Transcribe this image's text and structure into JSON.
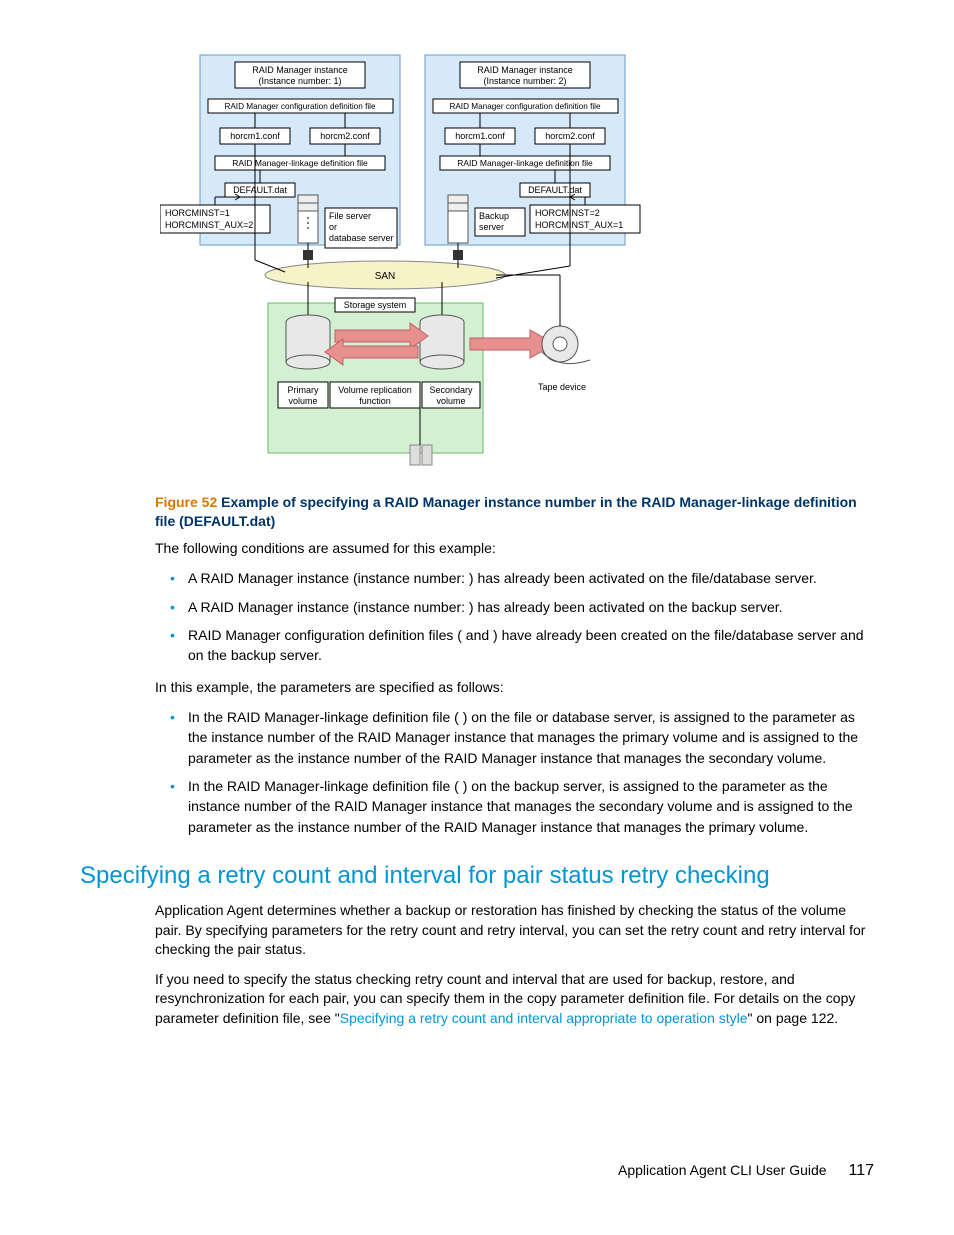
{
  "diagram": {
    "inst1_title_1": "RAID Manager instance",
    "inst1_title_2": "(Instance number: 1)",
    "inst2_title_1": "RAID Manager instance",
    "inst2_title_2": "(Instance number: 2)",
    "config_def_file": "RAID Manager configuration definition file",
    "horcm1": "horcm1.conf",
    "horcm2": "horcm2.conf",
    "linkage_file": "RAID Manager-linkage definition file",
    "default_dat": "DEFAULT.dat",
    "env1_1": "HORCMINST=1",
    "env1_2": "HORCMINST_AUX=2",
    "env2_1": "HORCMINST=2",
    "env2_2": "HORCMINST_AUX=1",
    "file_server_1": "File server",
    "file_server_2": "or",
    "file_server_3": "database server",
    "backup_server_1": "Backup",
    "backup_server_2": "server",
    "san": "SAN",
    "storage_system": "Storage system",
    "primary_vol_1": "Primary",
    "primary_vol_2": "volume",
    "vol_rep_1": "Volume replication",
    "vol_rep_2": "function",
    "secondary_vol_1": "Secondary",
    "secondary_vol_2": "volume",
    "tape_device": "Tape device"
  },
  "figure_caption_num": "Figure 52 ",
  "figure_caption_text": "Example of specifying a RAID Manager instance number in the RAID Manager-linkage definition file (DEFAULT.dat)",
  "p1": "The following conditions are assumed for this example:",
  "list1": {
    "i1": "A RAID Manager instance (instance number:   ) has already been activated on the file/database server.",
    "i2": "A RAID Manager instance (instance number:   ) has already been activated on the backup server.",
    "i3": "RAID Manager configuration definition files (                           and                          ) have already been created on the file/database server and on the backup server."
  },
  "p2": "In this example, the parameters are specified as follows:",
  "list2": {
    "i1": "In the RAID Manager-linkage definition file (                           ) on the file or database server,     is assigned to the parameter                       as the instance number of the RAID Manager instance that manages the primary volume and     is assigned to the parameter                               as the instance number of the RAID Manager instance that manages the secondary volume.",
    "i2": "In the RAID Manager-linkage definition file (                           ) on the backup server,     is assigned to the parameter                       as the instance number of the RAID Manager instance that manages the secondary volume and     is assigned to the parameter                               as the instance number of the RAID Manager instance that manages the primary volume."
  },
  "heading": "Specifying a retry count and interval for pair status retry checking",
  "p3": "Application Agent determines whether a backup or restoration has finished by checking the status of the volume pair. By specifying parameters for the retry count and retry interval, you can set the retry count and retry interval for checking the pair status.",
  "p4a": "If you need to specify the status checking retry count and interval that are used for backup, restore, and resynchronization for each pair, you can specify them in the copy parameter definition file. For details on the copy parameter definition file, see \"",
  "p4_link": "Specifying a retry count and interval appropriate to operation style",
  "p4b": "\" on page 122.",
  "footer_text": "Application Agent CLI User Guide",
  "footer_page": "117"
}
